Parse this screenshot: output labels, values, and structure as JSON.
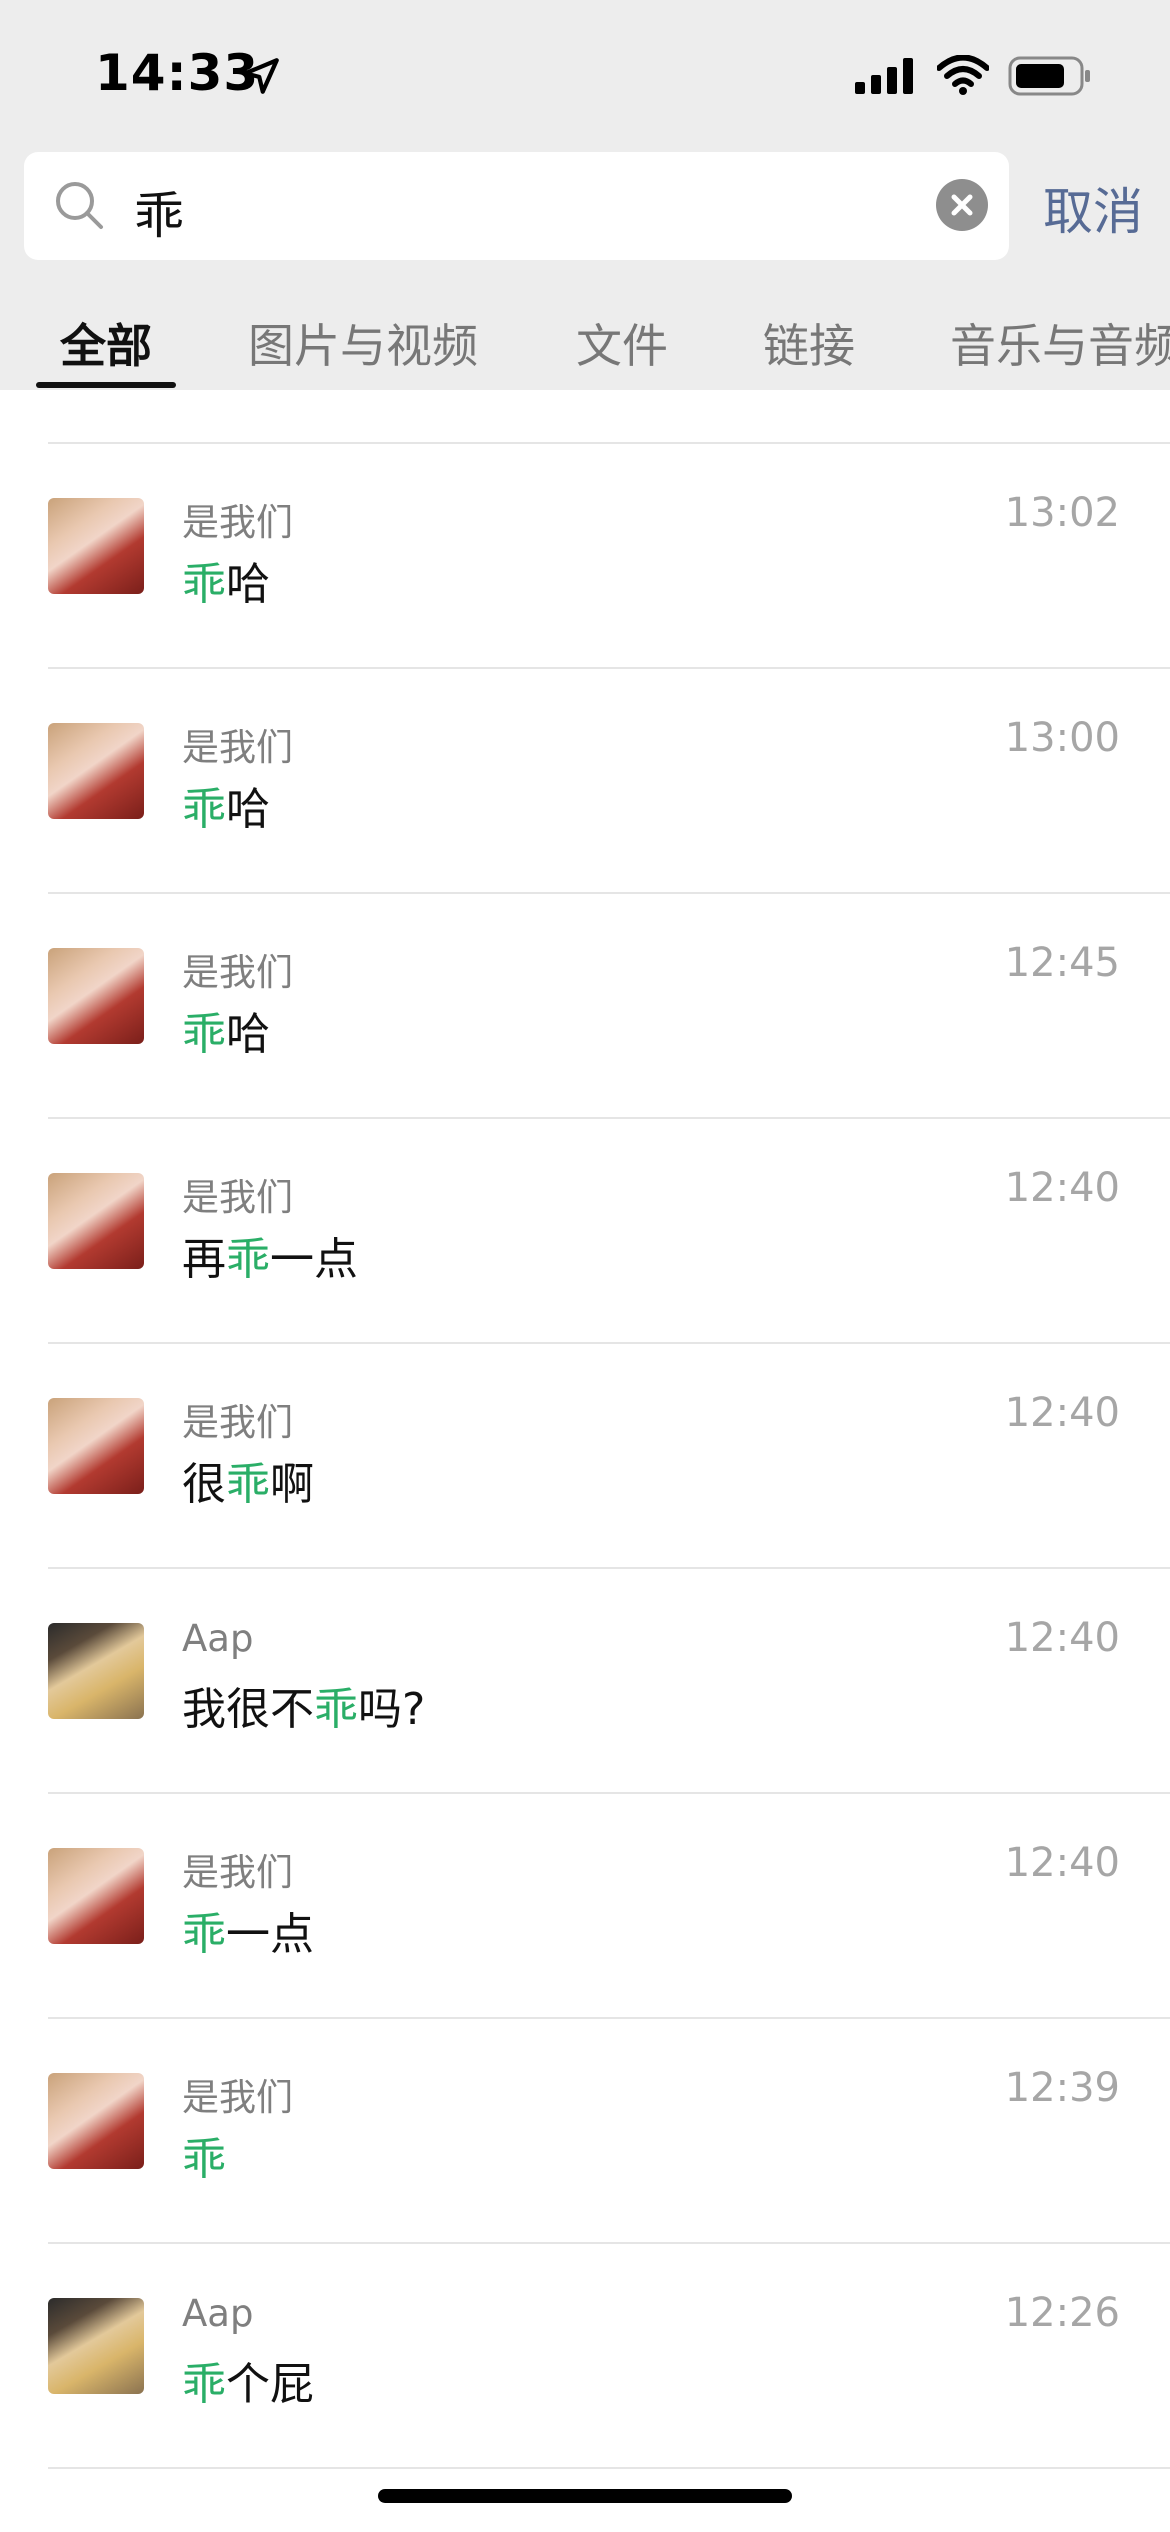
{
  "status_bar": {
    "time": "14:33",
    "icons": [
      "location-arrow-icon",
      "cellular-signal-icon",
      "wifi-icon",
      "battery-icon"
    ]
  },
  "search": {
    "value": "乖",
    "cancel_label": "取消"
  },
  "tabs": [
    {
      "label": "全部",
      "active": true
    },
    {
      "label": "图片与视频",
      "active": false
    },
    {
      "label": "文件",
      "active": false
    },
    {
      "label": "链接",
      "active": false
    },
    {
      "label": "音乐与音频",
      "active": false
    }
  ],
  "results": [
    {
      "sender": "是我们",
      "time": "13:02",
      "pre": "",
      "hl": "乖",
      "post": "哈",
      "avatar": "girl"
    },
    {
      "sender": "是我们",
      "time": "13:00",
      "pre": "",
      "hl": "乖",
      "post": "哈",
      "avatar": "girl"
    },
    {
      "sender": "是我们",
      "time": "12:45",
      "pre": "",
      "hl": "乖",
      "post": "哈",
      "avatar": "girl"
    },
    {
      "sender": "是我们",
      "time": "12:40",
      "pre": "再",
      "hl": "乖",
      "post": "一点",
      "avatar": "girl"
    },
    {
      "sender": "是我们",
      "time": "12:40",
      "pre": "很",
      "hl": "乖",
      "post": "啊",
      "avatar": "girl"
    },
    {
      "sender": "Aap",
      "time": "12:40",
      "pre": "我很不",
      "hl": "乖",
      "post": "吗?",
      "avatar": "guy"
    },
    {
      "sender": "是我们",
      "time": "12:40",
      "pre": "",
      "hl": "乖",
      "post": "一点",
      "avatar": "girl"
    },
    {
      "sender": "是我们",
      "time": "12:39",
      "pre": "",
      "hl": "乖",
      "post": "",
      "avatar": "girl"
    },
    {
      "sender": "Aap",
      "time": "12:26",
      "pre": "",
      "hl": "乖",
      "post": "个屁",
      "avatar": "guy"
    }
  ],
  "colors": {
    "highlight": "#2aae67",
    "cancel": "#576b95",
    "header_bg": "#ededed"
  }
}
